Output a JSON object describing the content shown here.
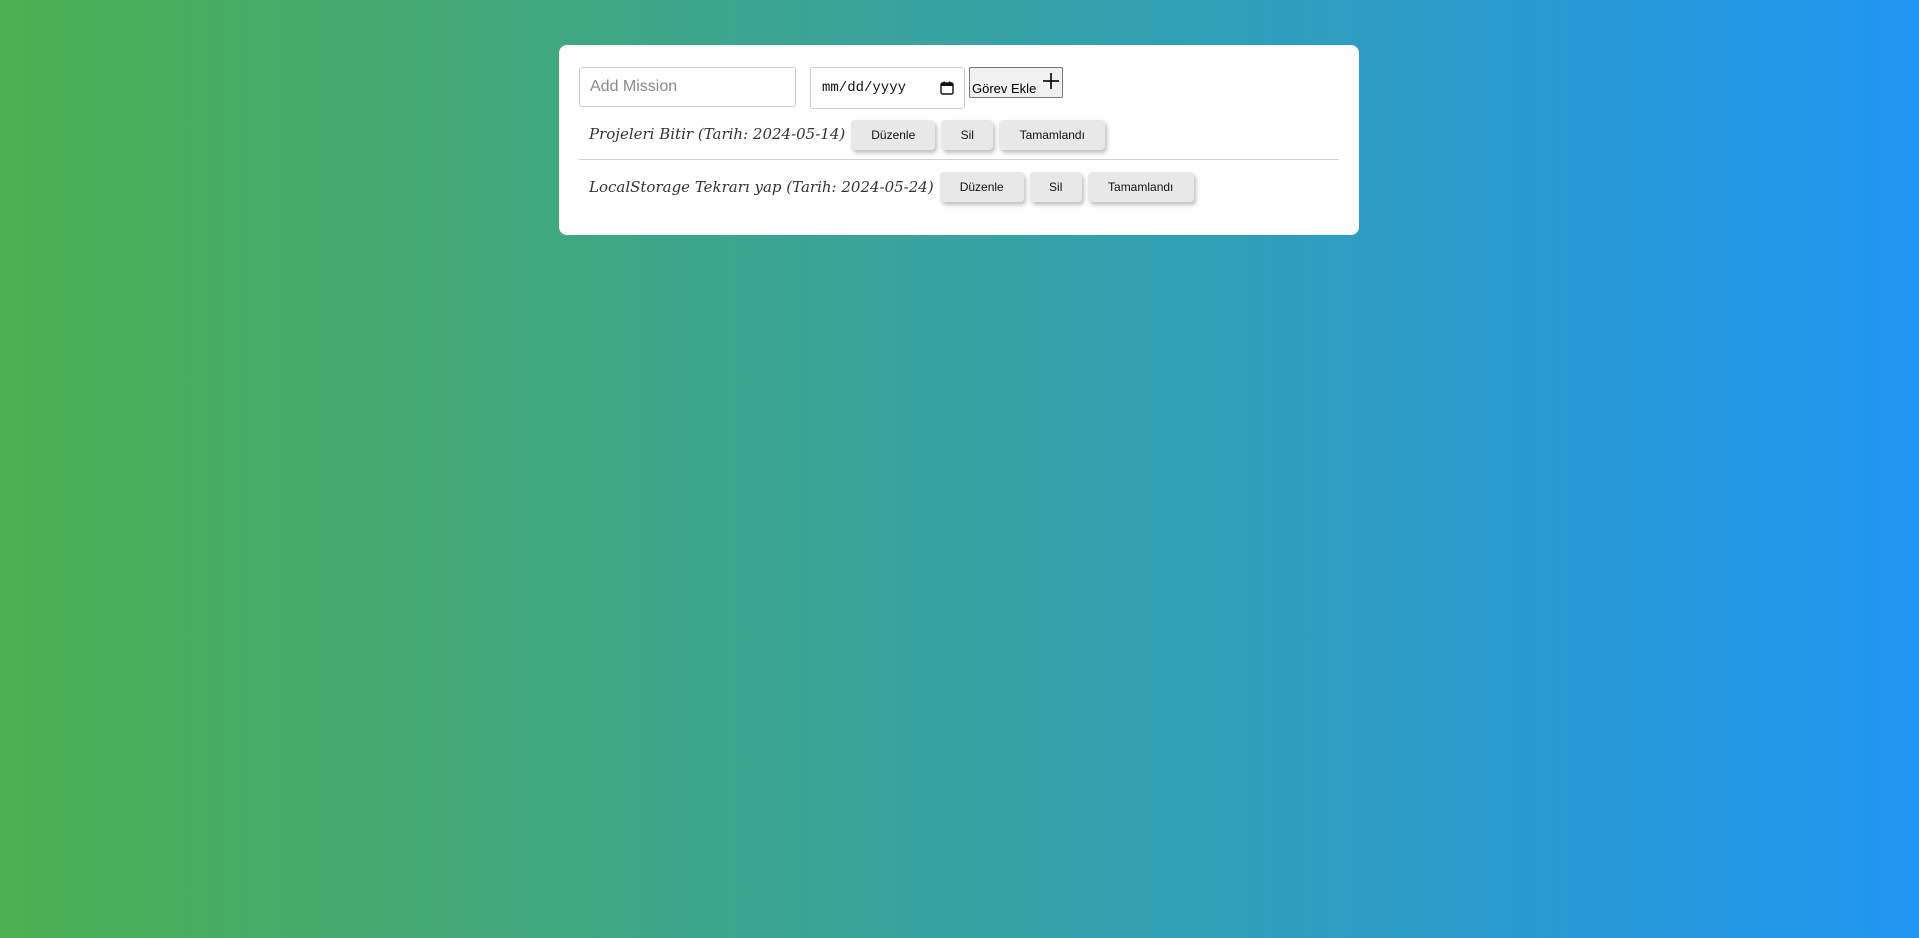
{
  "form": {
    "mission_placeholder": "Add Mission",
    "date_placeholder": "mm/dd/yyyy",
    "add_label": "Görev Ekle"
  },
  "tasks": [
    {
      "text": "Projeleri Bitir (Tarih: 2024-05-14)",
      "edit_label": "Düzenle",
      "delete_label": "Sil",
      "complete_label": "Tamamlandı"
    },
    {
      "text": "LocalStorage Tekrarı yap (Tarih: 2024-05-24)",
      "edit_label": "Düzenle",
      "delete_label": "Sil",
      "complete_label": "Tamamlandı"
    }
  ],
  "icons": {
    "add": "plus-icon",
    "date": "calendar-icon"
  },
  "colors": {
    "gradient_start": "#4caf50",
    "gradient_end": "#2196f3",
    "card": "#ffffff"
  }
}
